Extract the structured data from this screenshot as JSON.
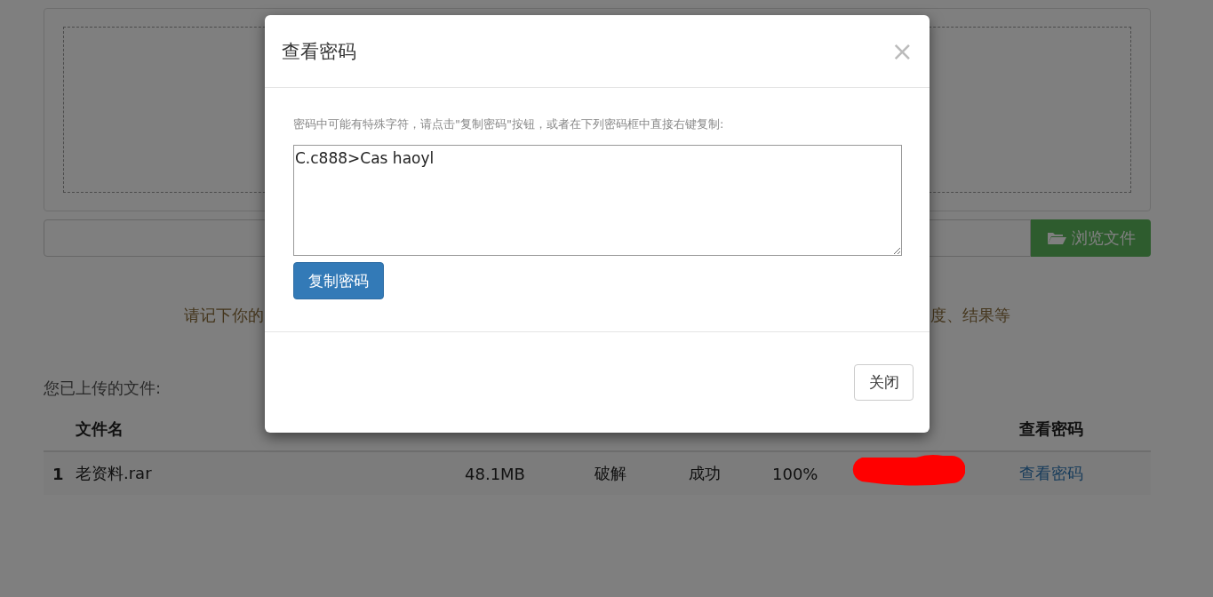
{
  "page": {
    "browse_button": "浏览文件",
    "notice_left": "请记下你的",
    "notice_right": "度、结果等",
    "files_heading": "您已上传的文件:"
  },
  "table": {
    "columns": [
      "文件名",
      "查看密码"
    ],
    "rows": [
      {
        "index": "1",
        "name": "老资料.rar",
        "size": "48.1MB",
        "method": "破解",
        "status": "成功",
        "progress": "100%",
        "link": "查看密码"
      }
    ]
  },
  "dialog": {
    "title": "查看密码",
    "close_icon": "×",
    "hint": "密码中可能有特殊字符，请点击\"复制密码\"按钮，或者在下列密码框中直接右键复制:",
    "password": "C.c888>Cas haoyl",
    "copy_button": "复制密码",
    "close_button": "关闭"
  }
}
